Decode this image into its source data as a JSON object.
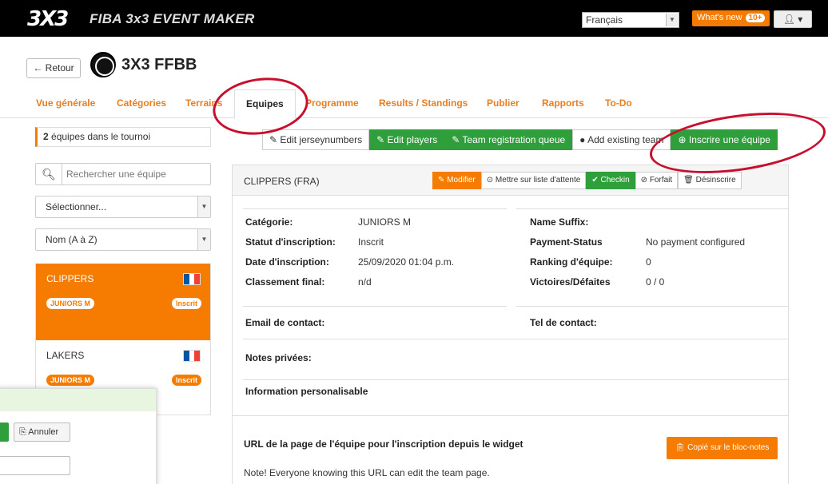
{
  "topbar": {
    "logo": "3X3",
    "title": "FIBA 3x3 EVENT MAKER",
    "language": "Français",
    "whats_new": "What's new",
    "whats_new_count": "10+"
  },
  "header": {
    "back_label": "← Retour",
    "event_name": "3X3 FFBB"
  },
  "tabs": [
    {
      "label": "Vue générale"
    },
    {
      "label": "Catégories"
    },
    {
      "label": "Terrains"
    },
    {
      "label": "Equipes"
    },
    {
      "label": "Programme"
    },
    {
      "label": "Results / Standings"
    },
    {
      "label": "Publier"
    },
    {
      "label": "Rapports"
    },
    {
      "label": "To-Do"
    }
  ],
  "sidebar": {
    "count_number": "2",
    "count_text": " équipes dans le tournoi",
    "search_placeholder": "Rechercher une équipe",
    "filter_select": "Sélectionner...",
    "sort_select": "Nom (A à Z)",
    "teams": [
      {
        "name": "CLIPPERS",
        "category": "JUNIORS M",
        "status": "Inscrit"
      },
      {
        "name": "LAKERS",
        "category": "JUNIORS M",
        "status": "Inscrit"
      }
    ]
  },
  "dialog": {
    "cancel_label": "Annuler"
  },
  "actions": {
    "edit_jersey": "Edit jerseynumbers",
    "edit_players": "Edit players",
    "registration_queue": "Team registration queue",
    "add_existing": "Add existing team",
    "register_team": "Inscrire une équipe"
  },
  "team_panel": {
    "title": "CLIPPERS (FRA)",
    "buttons": {
      "edit": "Modifier",
      "waitlist": "Mettre sur liste d'attente",
      "checkin": "Checkin",
      "forfeit": "Forfait",
      "unregister": "Désinscrire"
    },
    "fields": {
      "category_label": "Catégorie:",
      "category_value": "JUNIORS M",
      "status_label": "Statut d'inscription:",
      "status_value": "Inscrit",
      "date_label": "Date d'inscription:",
      "date_value": "25/09/2020 01:04 p.m.",
      "final_rank_label": "Classement final:",
      "final_rank_value": "n/d",
      "name_suffix_label": "Name Suffix:",
      "payment_label": "Payment-Status",
      "payment_value": "No payment configured",
      "ranking_label": "Ranking d'équipe:",
      "ranking_value": "0",
      "wins_label": "Victoires/Défaites",
      "wins_value": "0 / 0",
      "email_label": "Email de contact:",
      "phone_label": "Tel de contact:",
      "notes_label": "Notes privées:",
      "custom_info_label": "Information personalisable",
      "url_label": "URL de la page de l'équipe pour l'inscription depuis le widget",
      "copy_label": "Copié sur le bloc-notes",
      "note_text": "Note! Everyone knowing this URL can edit the team page."
    }
  },
  "colors": {
    "accent": "#f57c00",
    "green": "#2e9f3a",
    "annotation": "#c8102e"
  }
}
